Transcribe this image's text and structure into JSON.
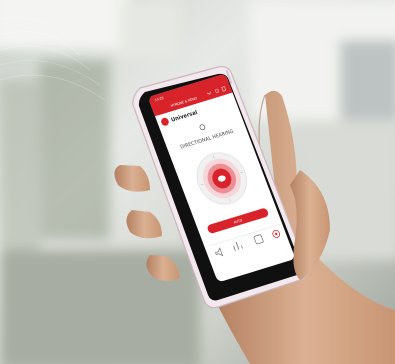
{
  "phone": {
    "status_time": "14:29",
    "header_program": "HYMONE & RDNO",
    "app_title": "Universal",
    "mode_label": "DIRECTIONAL HEARING",
    "action_label": "AUTO"
  },
  "colors": {
    "brand_red": "#d8232a",
    "background": "#e9ecea",
    "hand_skin": "#d7a887",
    "phone_frame": "#f0e6ea"
  },
  "icons": [
    "volume-icon",
    "equalizer-icon",
    "program-icon",
    "settings-icon"
  ]
}
